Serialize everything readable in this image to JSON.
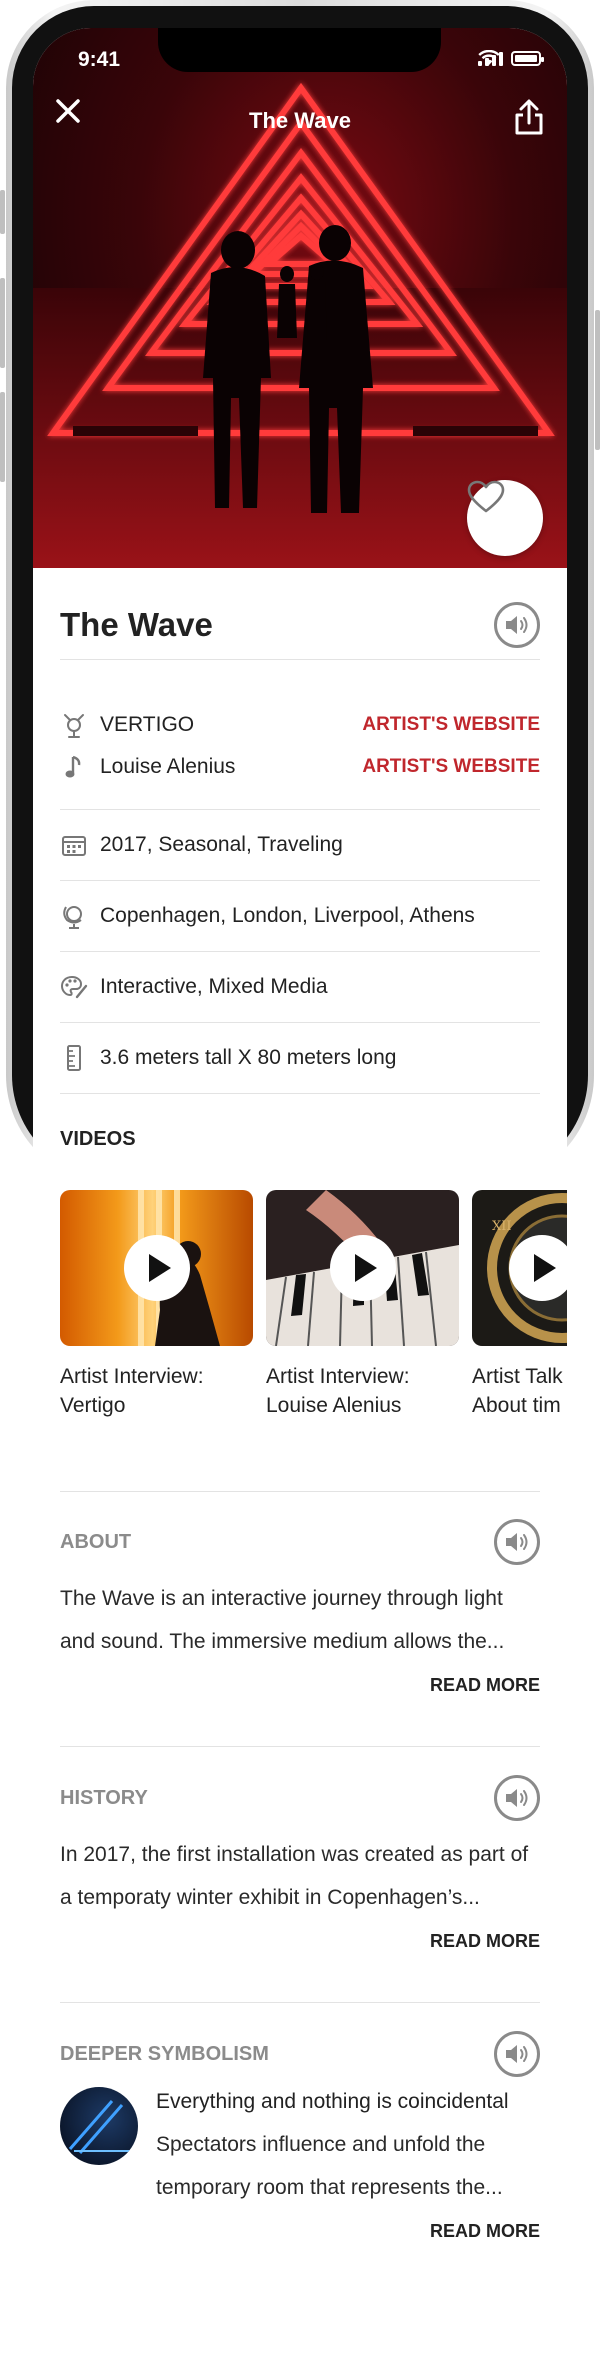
{
  "status_bar": {
    "time": "9:41"
  },
  "header": {
    "title": "The Wave"
  },
  "artwork": {
    "title": "The Wave",
    "credits": [
      {
        "name": "VERTIGO",
        "link_label": "ARTIST'S WEBSITE",
        "icon": "artist-icon"
      },
      {
        "name": "Louise Alenius",
        "link_label": "ARTIST'S WEBSITE",
        "icon": "music-note-icon"
      }
    ],
    "details": [
      {
        "icon": "calendar-icon",
        "text": "2017, Seasonal, Traveling"
      },
      {
        "icon": "globe-icon",
        "text": "Copenhagen, London, Liverpool, Athens"
      },
      {
        "icon": "palette-icon",
        "text": "Interactive, Mixed Media"
      },
      {
        "icon": "ruler-icon",
        "text": "3.6 meters tall X 80 meters long"
      }
    ]
  },
  "videos": {
    "heading": "VIDEOS",
    "items": [
      {
        "line1": "Artist Interview:",
        "line2": "Vertigo"
      },
      {
        "line1": "Artist Interview:",
        "line2": "Louise Alenius"
      },
      {
        "line1": "Artist Talk",
        "line2": "About tim"
      }
    ]
  },
  "about": {
    "heading": "ABOUT",
    "line1": "The Wave is an interactive journey through light",
    "line2": "and sound. The immersive medium allows the...",
    "read_more": "READ MORE"
  },
  "history": {
    "heading": "HISTORY",
    "line1": "In 2017, the first installation was created as part of",
    "line2": "a temporaty winter exhibit in Copenhagen’s...",
    "read_more": "READ MORE"
  },
  "symbolism": {
    "heading": "DEEPER SYMBOLISM",
    "title": "Everything and nothing is coincidental",
    "line1": "Spectators  influence and unfold the",
    "line2": "temporary room that represents the...",
    "read_more": "READ MORE"
  },
  "colors": {
    "accent": "#c0272d",
    "hero_red": "#ff2a2a",
    "text": "#222222",
    "muted": "#8b8b8b"
  }
}
